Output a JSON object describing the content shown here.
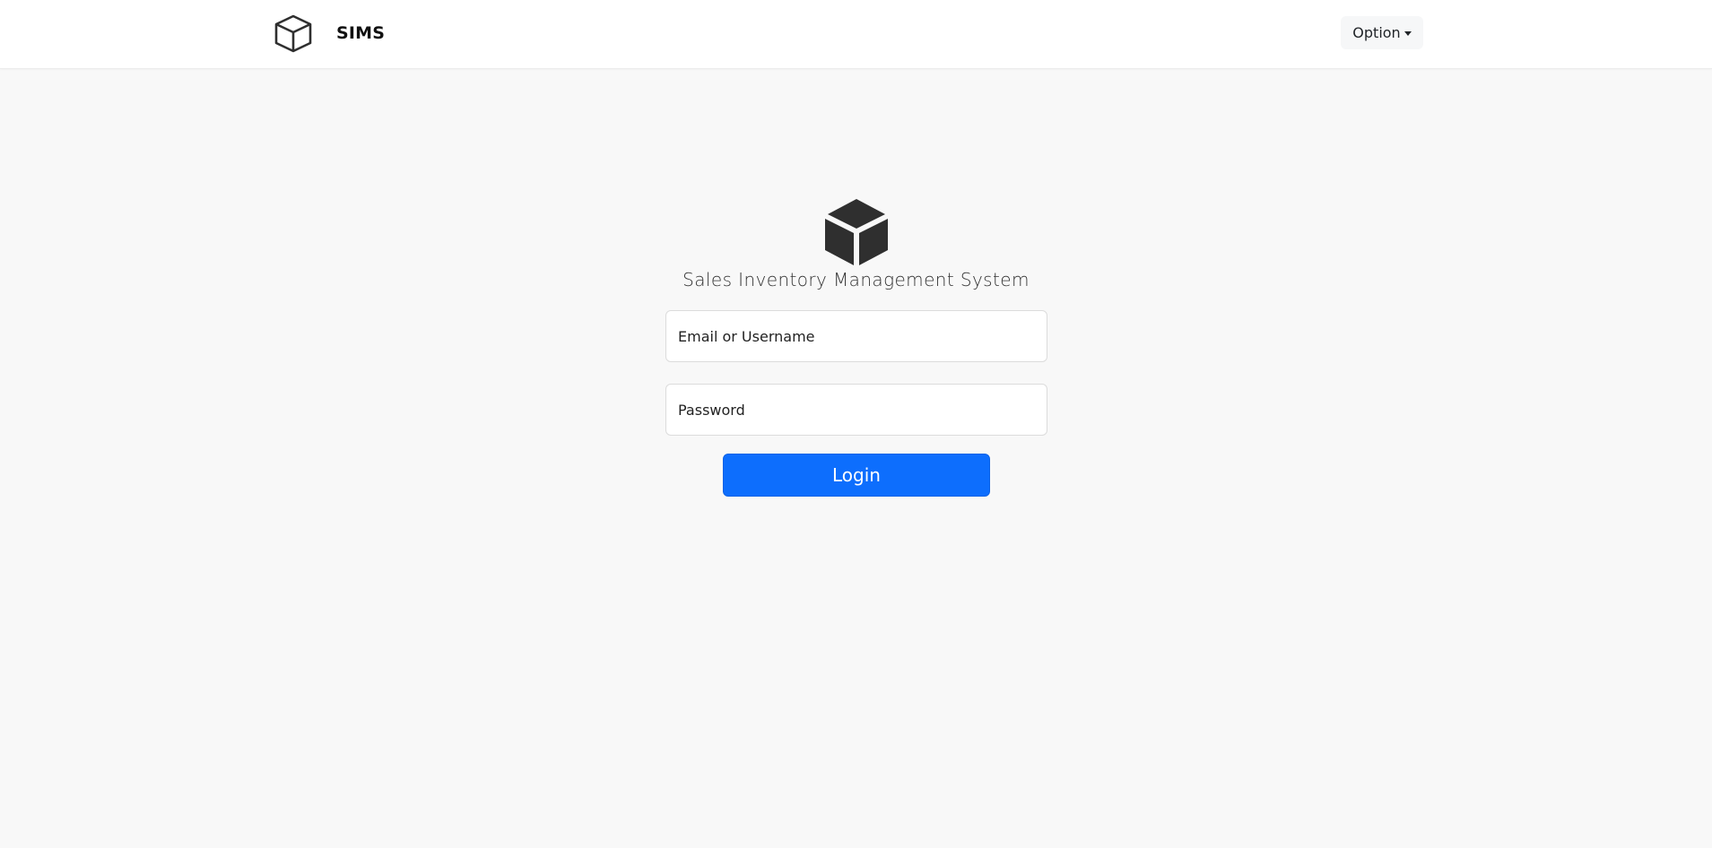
{
  "navbar": {
    "brand_icon": "box-outline-icon",
    "brand_title": "SIMS",
    "option_label": "Option",
    "option_icon": "caret-down-icon"
  },
  "login": {
    "hero_icon": "box-solid-icon",
    "title": "Sales Inventory Management System",
    "email_placeholder": "Email or Username",
    "email_value": "",
    "password_placeholder": "Password",
    "password_value": "",
    "submit_label": "Login"
  },
  "colors": {
    "primary": "#0d6efd",
    "background": "#f8f8f8",
    "navbar_background": "#ffffff",
    "icon_dark": "#2f2f2f"
  }
}
